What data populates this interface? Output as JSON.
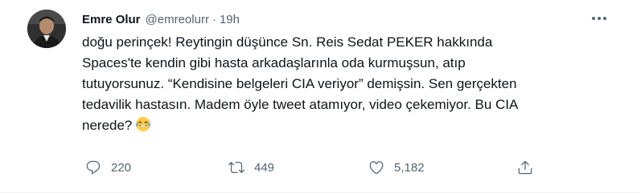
{
  "author": {
    "name": "Emre Olur",
    "handle": "@emreolurr",
    "separator": "·",
    "time": "19h"
  },
  "tweet": {
    "lines": [
      "doğu perinçek! Reytingin düşünce Sn. Reis Sedat PEKER hakkında",
      "Spaces'te kendin gibi hasta arkadaşlarınla oda kurmuşsun, atıp",
      "tutuyorsunuz. “Kendisine belgeleri CIA veriyor” demişsin. Sen gerçekten",
      "tedavilik hastasın. Madem öyle tweet atamıyor, video çekemiyor. Bu CIA",
      "nerede?"
    ],
    "emoji": "face-with-tears-of-joy"
  },
  "actions": {
    "reply": {
      "icon": "reply-icon",
      "count": "220"
    },
    "retweet": {
      "icon": "retweet-icon",
      "count": "449"
    },
    "like": {
      "icon": "heart-icon",
      "count": "5,182"
    },
    "share": {
      "icon": "share-icon"
    }
  },
  "colors": {
    "text": "#0f1419",
    "secondary": "#536471",
    "divider": "#eff3f4"
  }
}
